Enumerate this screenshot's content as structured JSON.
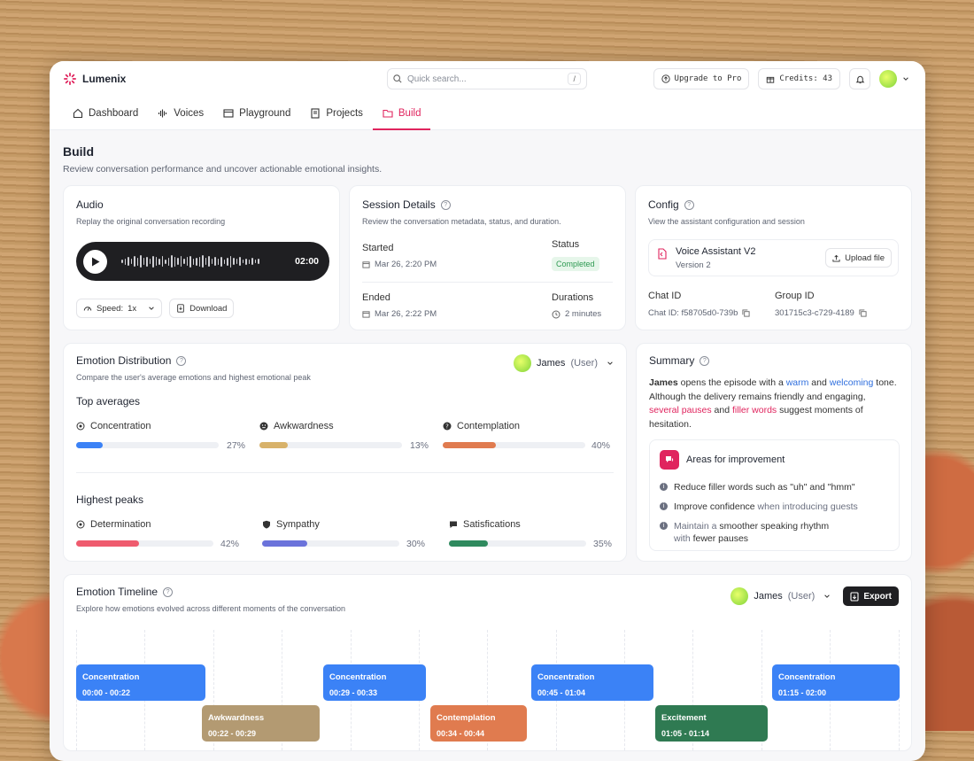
{
  "app": {
    "name": "Lumenix"
  },
  "search": {
    "placeholder": "Quick search...",
    "shortcut": "/"
  },
  "topbar": {
    "upgrade": "Upgrade to Pro",
    "credits": "Credits: 43"
  },
  "nav": {
    "tabs": [
      {
        "label": "Dashboard",
        "icon": "home-icon"
      },
      {
        "label": "Voices",
        "icon": "waveform-icon"
      },
      {
        "label": "Playground",
        "icon": "window-icon"
      },
      {
        "label": "Projects",
        "icon": "document-icon"
      },
      {
        "label": "Build",
        "icon": "folder-icon",
        "active": true
      }
    ]
  },
  "page": {
    "title": "Build",
    "subtitle": "Review conversation performance and uncover actionable emotional insights."
  },
  "audio": {
    "title": "Audio",
    "subtitle": "Replay the original conversation recording",
    "time": "02:00",
    "speed": "Speed:",
    "speed_value": "1x",
    "download": "Download"
  },
  "session": {
    "title": "Session Details",
    "subtitle": "Review the conversation metadata, status, and duration.",
    "started_label": "Started",
    "started": "Mar 26, 2:20 PM",
    "status_label": "Status",
    "status": "Completed",
    "ended_label": "Ended",
    "ended": "Mar 26, 2:22 PM",
    "durations_label": "Durations",
    "duration": "2 minutes"
  },
  "config": {
    "title": "Config",
    "subtitle": "View the assistant configuration and session",
    "assistant": "Voice Assistant V2",
    "version": "Version 2",
    "upload": "Upload file",
    "chat_label": "Chat ID",
    "chat_id": "Chat ID: f58705d0-739b",
    "group_label": "Group ID",
    "group_id": "301715c3-c729-4189"
  },
  "emotion": {
    "title": "Emotion Distribution",
    "subtitle": "Compare the user's average emotions and highest emotional peak",
    "user": "James",
    "role": "(User)",
    "top_label": "Top averages",
    "top": [
      {
        "name": "Concentration",
        "pct": "27%",
        "value": 0.18,
        "color": "#3b82f6"
      },
      {
        "name": "Awkwardness",
        "pct": "13%",
        "value": 0.2,
        "color": "#d8b26a"
      },
      {
        "name": "Contemplation",
        "pct": "40%",
        "value": 0.4,
        "color": "#e07b4f"
      }
    ],
    "peaks_label": "Highest peaks",
    "peaks": [
      {
        "name": "Determination",
        "pct": "42%",
        "value": 0.46,
        "color": "#ef5b6e"
      },
      {
        "name": "Sympathy",
        "pct": "30%",
        "value": 0.3,
        "color": "#6b73db"
      },
      {
        "name": "Satisfications",
        "pct": "35%",
        "value": 0.33,
        "color": "#2f8a5e"
      }
    ]
  },
  "summary": {
    "title": "Summary",
    "p1": "James",
    "p2": " opens the episode with a ",
    "p3": "warm",
    "p4": " and ",
    "p5": "welcoming",
    "p6": " tone. Although the delivery remains friendly and engaging, ",
    "p7": "several pauses",
    "p8": " and ",
    "p9": "filler words",
    "p10": " suggest moments of hesitation.",
    "areas_title": "Areas for improvement",
    "a1": "Reduce filler words such as \"uh\" and \"hmm\"",
    "a2a": "Improve confidence",
    "a2b": " when introducing guests",
    "a3a": "Maintain a ",
    "a3b": "smoother speaking rhythm",
    "a3c": "with ",
    "a3d": "fewer pauses"
  },
  "timeline": {
    "title": "Emotion Timeline",
    "subtitle": "Explore how emotions evolved across different moments of the conversation",
    "user": "James",
    "role": "(User)",
    "export": "Export",
    "blocks": [
      {
        "name": "Concentration",
        "time": "00:00 - 00:22",
        "color": "#3b82f6"
      },
      {
        "name": "Concentration",
        "time": "00:29 - 00:33",
        "color": "#3b82f6"
      },
      {
        "name": "Concentration",
        "time": "00:45 - 01:04",
        "color": "#3b82f6"
      },
      {
        "name": "Concentration",
        "time": "01:15 - 02:00",
        "color": "#3b82f6"
      },
      {
        "name": "Awkwardness",
        "time": "00:22 - 00:29",
        "color": "#b39a72"
      },
      {
        "name": "Contemplation",
        "time": "00:34 - 00:44",
        "color": "#e07b4f"
      },
      {
        "name": "Excitement",
        "time": "01:05 - 01:14",
        "color": "#2f7a52"
      }
    ]
  }
}
